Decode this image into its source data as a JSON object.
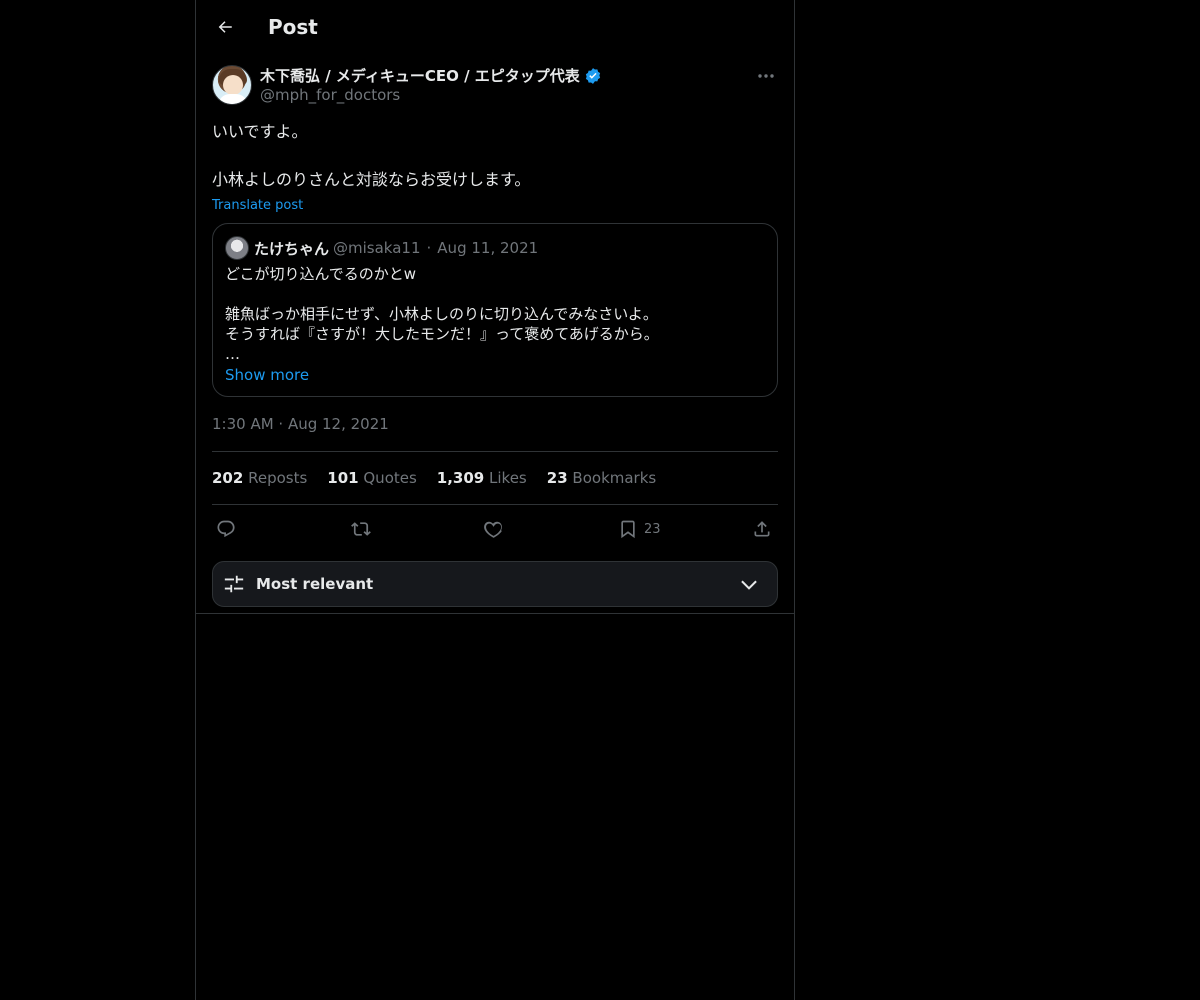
{
  "header": {
    "title": "Post",
    "back_icon": "arrow-left-icon"
  },
  "post": {
    "author": {
      "display_name": "木下喬弘 / メディキューCEO / エピタップ代表",
      "handle": "@mph_for_doctors",
      "verified": true
    },
    "text": "いいですよ。\n\n小林よしのりさんと対談ならお受けします。",
    "translate_label": "Translate post",
    "quoted": {
      "display_name": "たけちゃん",
      "handle": "@misaka11",
      "separator": "·",
      "date": "Aug 11, 2021",
      "text": "どこが切り込んでるのかとw\n\n雑魚ばっか相手にせず、小林よしのりに切り込んでみなさいよ。\nそうすれば『さすが！大したモンだ！』って褒めてあげるから。\n…",
      "show_more": "Show more"
    },
    "timestamp": "1:30 AM · Aug 12, 2021",
    "stats": [
      {
        "count": "202",
        "label": "Reposts"
      },
      {
        "count": "101",
        "label": "Quotes"
      },
      {
        "count": "1,309",
        "label": "Likes"
      },
      {
        "count": "23",
        "label": "Bookmarks"
      }
    ],
    "actions": {
      "reply_icon": "reply-icon",
      "repost_icon": "repost-icon",
      "like_icon": "heart-icon",
      "bookmark_icon": "bookmark-icon",
      "bookmark_count": "23",
      "share_icon": "share-icon"
    }
  },
  "sort": {
    "label": "Most relevant"
  },
  "colors": {
    "background": "#000000",
    "text": "#e7e9ea",
    "muted": "#71767b",
    "accent": "#1d9bf0",
    "border": "#2f3336"
  }
}
